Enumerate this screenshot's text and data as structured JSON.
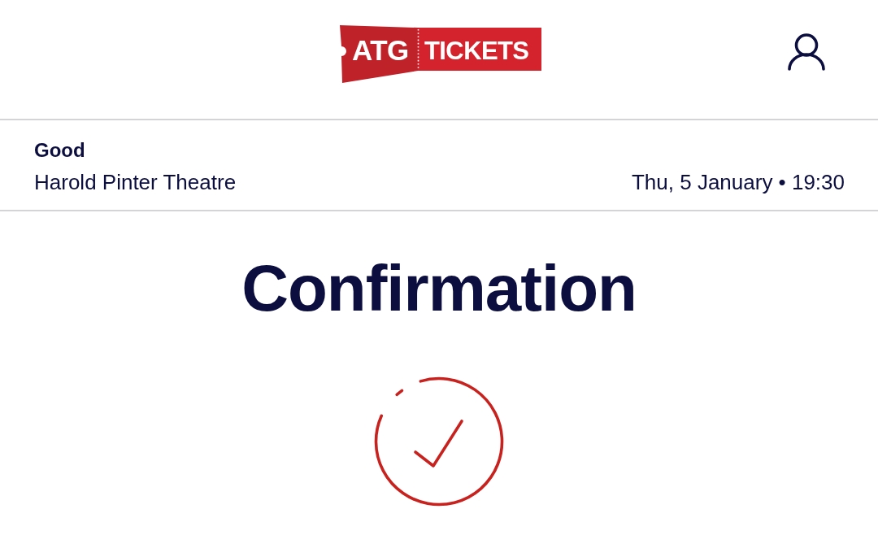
{
  "header": {
    "logo": [
      "ATG",
      "TICKETS"
    ]
  },
  "event": {
    "title": "Good",
    "venue": "Harold Pinter Theatre",
    "datetime": "Thu, 5 January • 19:30"
  },
  "page": {
    "heading": "Confirmation",
    "status": {
      "kind": "success"
    }
  }
}
